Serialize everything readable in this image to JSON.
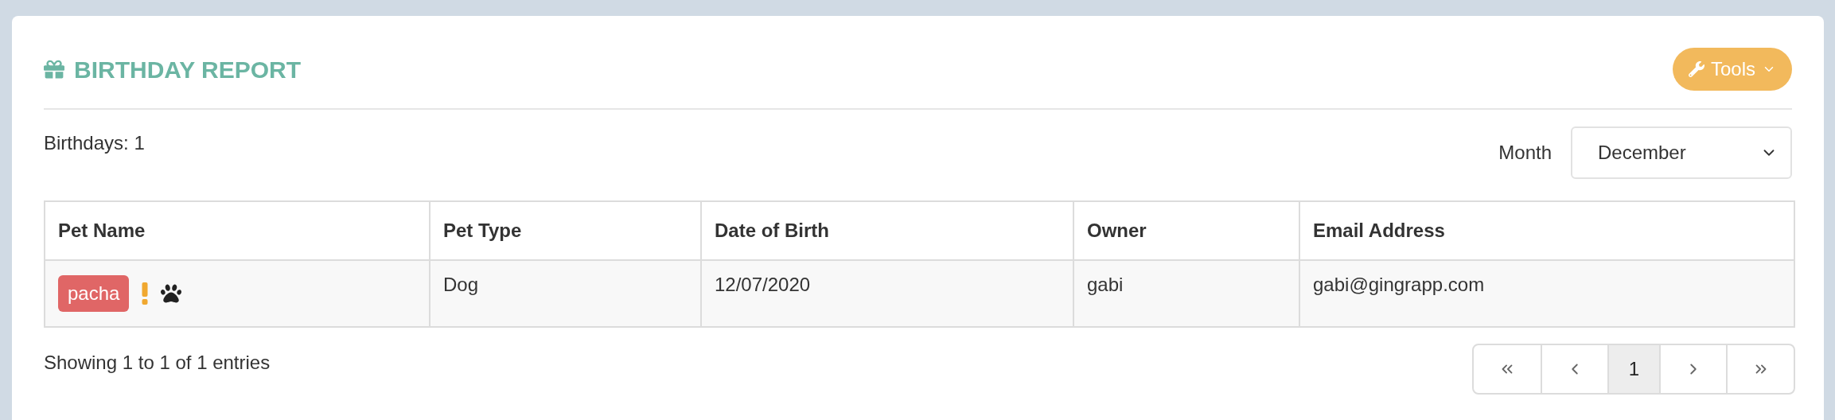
{
  "header": {
    "title": "BIRTHDAY REPORT",
    "tools_button": "Tools"
  },
  "summary": "Birthdays: 1",
  "month_filter": {
    "label": "Month",
    "value": "December"
  },
  "table": {
    "columns": [
      "Pet Name",
      "Pet Type",
      "Date of Birth",
      "Owner",
      "Email Address"
    ],
    "rows": [
      {
        "pet_name": "pacha",
        "alert": true,
        "pet_type": "Dog",
        "date_of_birth": "12/07/2020",
        "owner": "gabi",
        "email": "gabi@gingrapp.com"
      }
    ]
  },
  "footer": {
    "info": "Showing 1 to 1 of 1 entries",
    "pages": [
      {
        "label": "1",
        "selected": true
      }
    ]
  }
}
